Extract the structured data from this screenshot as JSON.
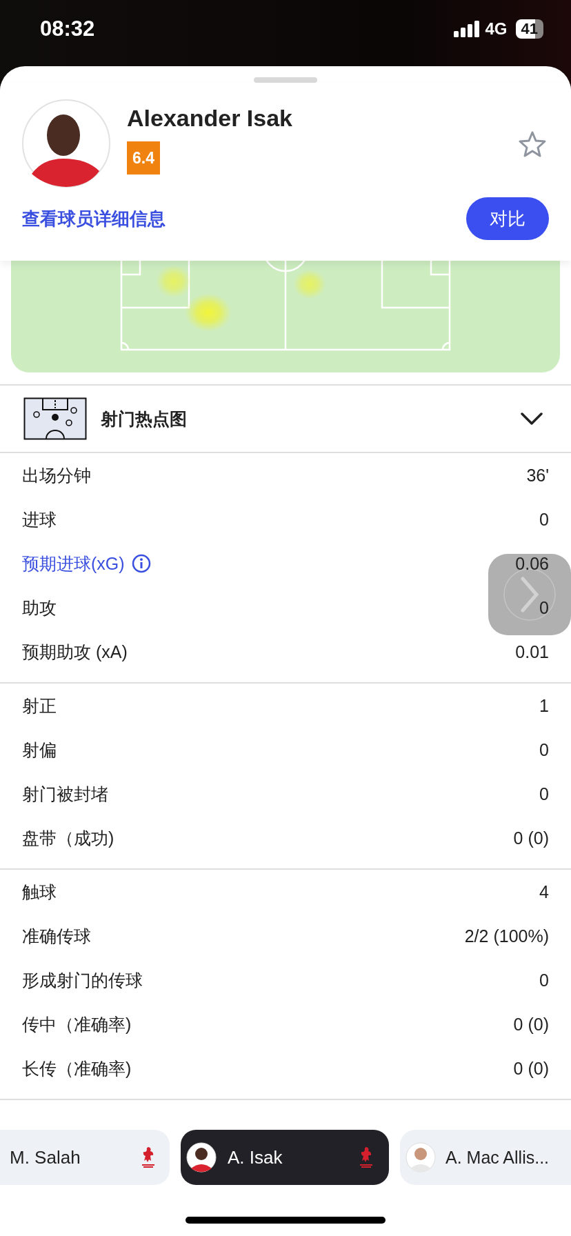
{
  "status_bar": {
    "time": "08:32",
    "network": "4G",
    "battery": "41"
  },
  "player": {
    "name": "Alexander Isak",
    "rating": "6.4",
    "favorite": false,
    "details_link": "查看球员详细信息",
    "compare_button": "对比"
  },
  "shot_map": {
    "title": "射门热点图",
    "expanded": false
  },
  "stat_groups": [
    [
      {
        "label": "出场分钟",
        "value": "36'",
        "kind": "plain"
      },
      {
        "label": "进球",
        "value": "0",
        "kind": "plain"
      },
      {
        "label": "预期进球(xG)",
        "value": "0.06",
        "kind": "info"
      },
      {
        "label": "助攻",
        "value": "0",
        "kind": "plain"
      },
      {
        "label": "预期助攻 (xA)",
        "value": "0.01",
        "kind": "plain"
      }
    ],
    [
      {
        "label": "射正",
        "value": "1",
        "kind": "plain"
      },
      {
        "label": "射偏",
        "value": "0",
        "kind": "plain"
      },
      {
        "label": "射门被封堵",
        "value": "0",
        "kind": "plain"
      },
      {
        "label": "盘带（成功)",
        "value": "0 (0)",
        "kind": "plain"
      }
    ],
    [
      {
        "label": "触球",
        "value": "4",
        "kind": "plain"
      },
      {
        "label": "准确传球",
        "value": "2/2 (100%)",
        "kind": "plain"
      },
      {
        "label": "形成射门的传球",
        "value": "0",
        "kind": "plain"
      },
      {
        "label": "传中（准确率)",
        "value": "0 (0)",
        "kind": "plain"
      },
      {
        "label": "长传（准确率)",
        "value": "0 (0)",
        "kind": "plain"
      }
    ]
  ],
  "player_tabs": [
    {
      "name": "M. Salah",
      "selected": false,
      "avatar": false
    },
    {
      "name": "A. Isak",
      "selected": true,
      "avatar": true
    },
    {
      "name": "A. Mac Allis...",
      "selected": false,
      "avatar": true
    }
  ]
}
